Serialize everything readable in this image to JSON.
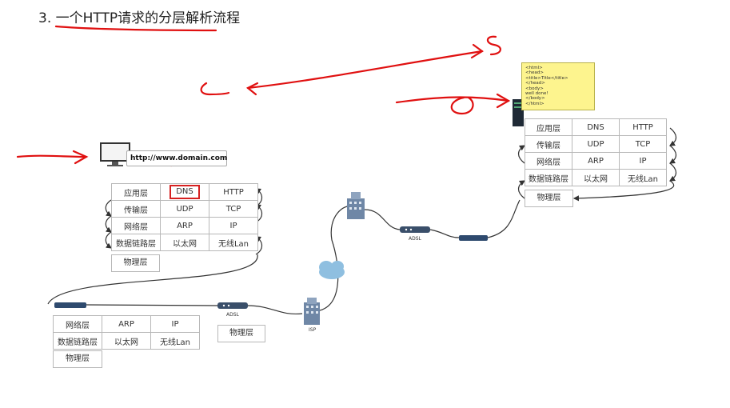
{
  "title": "3. 一个HTTP请求的分层解析流程",
  "url": "http://www.domain.com",
  "html_note": [
    "<html>",
    "<head>",
    "<title>Title</title>",
    "</head>",
    "<body>",
    "well done!",
    "</body>",
    "</html>"
  ],
  "client_stack": {
    "rows": [
      [
        "应用层",
        "DNS",
        "HTTP"
      ],
      [
        "传输层",
        "UDP",
        "TCP"
      ],
      [
        "网络层",
        "ARP",
        "IP"
      ],
      [
        "数据链路层",
        "以太网",
        "无线Lan"
      ]
    ],
    "physical": "物理层"
  },
  "server_stack": {
    "rows": [
      [
        "应用层",
        "DNS",
        "HTTP"
      ],
      [
        "传输层",
        "UDP",
        "TCP"
      ],
      [
        "网络层",
        "ARP",
        "IP"
      ],
      [
        "数据链路层",
        "以太网",
        "无线Lan"
      ]
    ],
    "physical": "物理层"
  },
  "router_stack": {
    "rows": [
      [
        "网络层",
        "ARP",
        "IP"
      ],
      [
        "数据链路层",
        "以太网",
        "无线Lan"
      ]
    ],
    "physical": "物理层"
  },
  "adsl_physical": "物理层",
  "labels": {
    "adsl_left": "ADSL",
    "adsl_right": "ADSL",
    "isp": "ISP"
  },
  "annotation_color": "#e01010",
  "cloud_color": "#8fbfe0",
  "device_color": "#2e4a6e"
}
